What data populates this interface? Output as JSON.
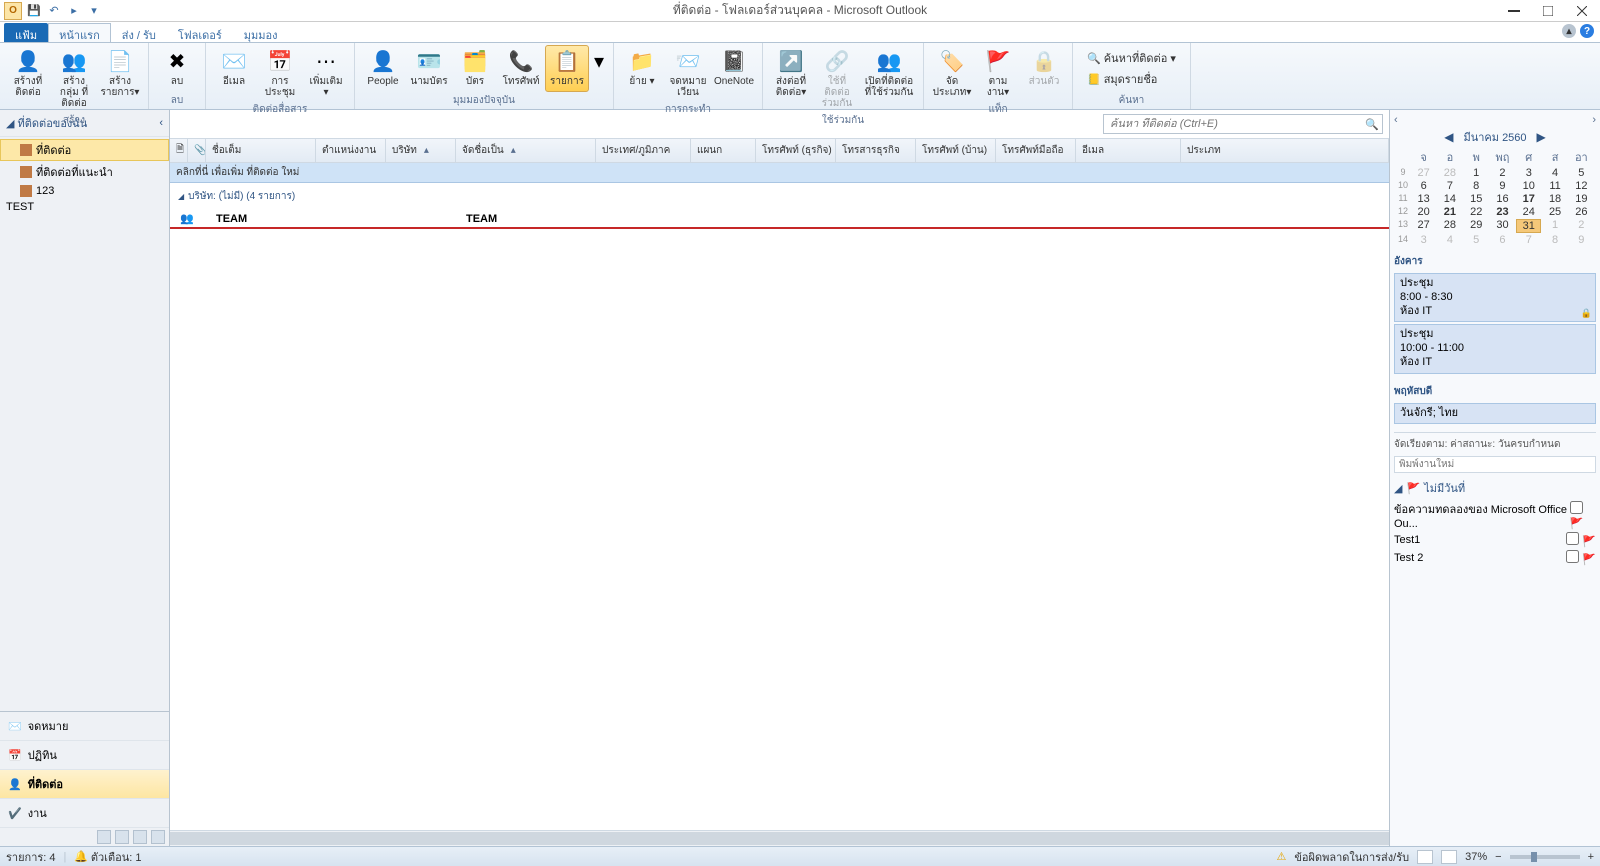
{
  "window": {
    "title": "ที่ติดต่อ - โฟลเดอร์ส่วนบุคคล - Microsoft Outlook"
  },
  "ribbon": {
    "tabs": {
      "file": "แฟ้ม",
      "home": "หน้าแรก",
      "sendreceive": "ส่ง / รับ",
      "folder": "โฟลเดอร์",
      "view": "มุมมอง"
    },
    "groups": {
      "new": {
        "btn1": "สร้างที่\nติดต่อ",
        "btn2": "สร้างกลุ่ม\nที่ติดต่อ",
        "btn3": "สร้าง\nรายการ▾",
        "label": "สร้าง"
      },
      "delete": {
        "btn": "ลบ",
        "label": "ลบ"
      },
      "communicate": {
        "email": "อีเมล",
        "meeting": "การ\nประชุม",
        "more": "เพิ่มเติม\n▾",
        "label": "ติดต่อสื่อสาร"
      },
      "view": {
        "people": "People",
        "bizcard": "นามบัตร",
        "card": "บัตร",
        "phone": "โทรศัพท์",
        "list": "รายการ",
        "label": "มุมมองปัจจุบัน"
      },
      "actions": {
        "move": "ย้าย\n▾",
        "mailmerge": "จดหมาย\nเวียน",
        "onenote": "OneNote",
        "label": "การกระทำ"
      },
      "share": {
        "fwd": "ส่งต่อที่\nติดต่อ▾",
        "share": "ใช้ที่ติดต่อ\nร่วมกัน",
        "open": "เปิดที่ติดต่อ\nที่ใช้ร่วมกัน",
        "label": "ใช้ร่วมกัน"
      },
      "tags": {
        "cat": "จัด\nประเภท▾",
        "followup": "ตาม\nงาน▾",
        "private": "ส่วนตัว",
        "label": "แท็ก"
      },
      "find": {
        "search": "ค้นหาที่ติดต่อ ▾",
        "addressbook": "สมุดรายชื่อ",
        "label": "ค้นหา"
      }
    }
  },
  "nav": {
    "header": "ที่ติดต่อของฉัน",
    "items": {
      "contacts": "ที่ติดต่อ",
      "suggested": "ที่ติดต่อที่แนะนำ",
      "n123": "123"
    },
    "test": "TEST",
    "switches": {
      "mail": "จดหมาย",
      "calendar": "ปฏิทิน",
      "contacts": "ที่ติดต่อ",
      "tasks": "งาน"
    }
  },
  "content": {
    "search_placeholder": "ค้นหา ที่ติดต่อ (Ctrl+E)",
    "columns": {
      "fullname": "ชื่อเต็ม",
      "jobtitle": "ตำแหน่งงาน",
      "company": "บริษัท",
      "fileas": "จัดชื่อเป็น",
      "country": "ประเทศ/ภูมิภาค",
      "dept": "แผนก",
      "bizphone": "โทรศัพท์ (ธุรกิจ)",
      "bizfax": "โทรสารธุรกิจ",
      "homephone": "โทรศัพท์ (บ้าน)",
      "mobile": "โทรศัพท์มือถือ",
      "email": "อีเมล",
      "category": "ประเภท"
    },
    "newrow": "คลิกที่นี่ เพื่อเพิ่ม ที่ติดต่อ ใหม่",
    "group_header": "บริษัท: (ไม่มี) (4 รายการ)",
    "row": {
      "name": "TEAM",
      "fileas": "TEAM"
    }
  },
  "calendar": {
    "month": "มีนาคม 2560",
    "dow": [
      "จ",
      "อ",
      "พ",
      "พฤ",
      "ศ",
      "ส",
      "อา"
    ],
    "weeks": [
      {
        "wn": "9",
        "days": [
          {
            "d": "27",
            "dim": true
          },
          {
            "d": "28",
            "dim": true
          },
          {
            "d": "1"
          },
          {
            "d": "2"
          },
          {
            "d": "3"
          },
          {
            "d": "4"
          },
          {
            "d": "5"
          }
        ]
      },
      {
        "wn": "10",
        "days": [
          {
            "d": "6"
          },
          {
            "d": "7"
          },
          {
            "d": "8"
          },
          {
            "d": "9"
          },
          {
            "d": "10"
          },
          {
            "d": "11"
          },
          {
            "d": "12"
          }
        ]
      },
      {
        "wn": "11",
        "days": [
          {
            "d": "13"
          },
          {
            "d": "14"
          },
          {
            "d": "15"
          },
          {
            "d": "16"
          },
          {
            "d": "17",
            "bold": true
          },
          {
            "d": "18"
          },
          {
            "d": "19"
          }
        ]
      },
      {
        "wn": "12",
        "days": [
          {
            "d": "20"
          },
          {
            "d": "21",
            "bold": true
          },
          {
            "d": "22"
          },
          {
            "d": "23",
            "bold": true
          },
          {
            "d": "24"
          },
          {
            "d": "25"
          },
          {
            "d": "26"
          }
        ]
      },
      {
        "wn": "13",
        "days": [
          {
            "d": "27"
          },
          {
            "d": "28"
          },
          {
            "d": "29"
          },
          {
            "d": "30"
          },
          {
            "d": "31",
            "today": true
          },
          {
            "d": "1",
            "dim": true
          },
          {
            "d": "2",
            "dim": true
          }
        ]
      },
      {
        "wn": "14",
        "days": [
          {
            "d": "3",
            "dim": true
          },
          {
            "d": "4",
            "dim": true
          },
          {
            "d": "5",
            "dim": true
          },
          {
            "d": "6",
            "dim": true
          },
          {
            "d": "7",
            "dim": true
          },
          {
            "d": "8",
            "dim": true
          },
          {
            "d": "9",
            "dim": true
          }
        ]
      }
    ],
    "tue": {
      "label": "อังคาร",
      "appt1": {
        "subj": "ประชุม",
        "time": "8:00 - 8:30",
        "loc": "ห้อง IT"
      },
      "appt2": {
        "subj": "ประชุม",
        "time": "10:00 - 11:00",
        "loc": "ห้อง IT"
      }
    },
    "thu": {
      "label": "พฤหัสบดี",
      "appt": {
        "text": "วันจักรี; ไทย"
      }
    }
  },
  "tasks": {
    "header": "จัดเรียงตาม: ค่าสถานะ: วันครบกำหนด",
    "input_placeholder": "พิมพ์งานใหม่",
    "group": "ไม่มีวันที่",
    "items": {
      "t1": "ข้อความทดลองของ Microsoft Office Ou...",
      "t2": "Test1",
      "t3": "Test 2"
    }
  },
  "status": {
    "items": "รายการ: 4",
    "reminder": "ตัวเตือน: 1",
    "error": "ข้อผิดพลาดในการส่ง/รับ",
    "zoom": "37%"
  }
}
